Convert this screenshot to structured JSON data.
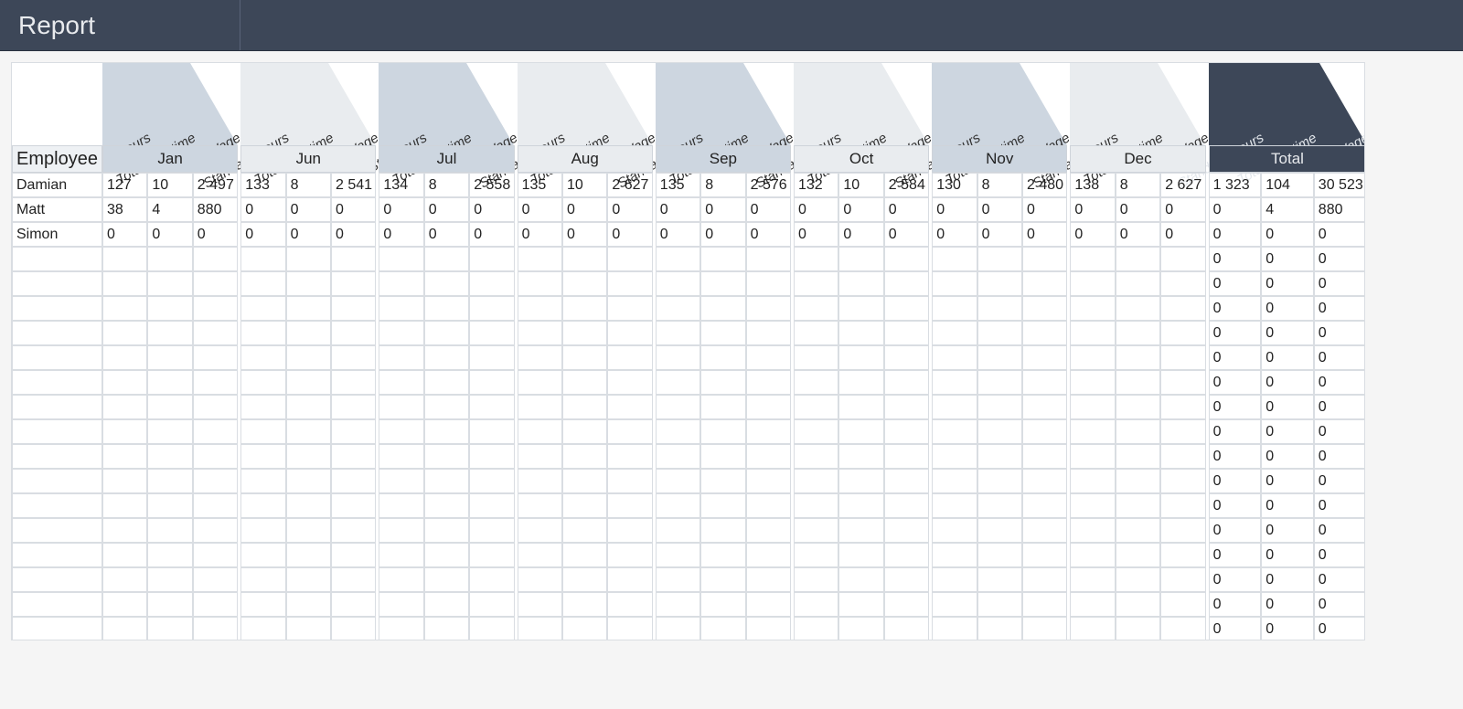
{
  "title": "Report",
  "column_label": "Employee",
  "sub_headers_short_first": [
    "Std. Hours",
    "Total Overtime",
    "Total Wage"
  ],
  "sub_headers_short_jul": [
    "Std. Hours",
    "Total Overtime",
    "Total Wage"
  ],
  "sub_headers_full": [
    "Standard Hours",
    "Total Overtime",
    "Total Wage"
  ],
  "periods": [
    "Jan",
    "Jun",
    "Jul",
    "Aug",
    "Sep",
    "Oct",
    "Nov",
    "Dec"
  ],
  "total_label": "Total",
  "period_shades": [
    "alt1",
    "alt2",
    "alt1",
    "alt2",
    "alt1",
    "alt2",
    "alt1",
    "alt2"
  ],
  "colors": {
    "alt1": "#cdd6e0",
    "alt2": "#e9ecef",
    "total_bg": "#3d4758",
    "total_fg": "#e8eaed"
  },
  "layout": {
    "name_w": 99,
    "sub_w": 49.4,
    "gap": 3,
    "total_sub_w": 57.6
  },
  "rows": [
    {
      "name": "Damian",
      "periods": [
        [
          "127",
          "10",
          "2 497"
        ],
        [
          "133",
          "8",
          "2 541"
        ],
        [
          "134",
          "8",
          "2 558"
        ],
        [
          "135",
          "10",
          "2 627"
        ],
        [
          "135",
          "8",
          "2 576"
        ],
        [
          "132",
          "10",
          "2 584"
        ],
        [
          "130",
          "8",
          "2 480"
        ],
        [
          "138",
          "8",
          "2 627"
        ]
      ],
      "total": [
        "1 323",
        "104",
        "30 523"
      ]
    },
    {
      "name": "Matt",
      "periods": [
        [
          "38",
          "4",
          "880"
        ],
        [
          "0",
          "0",
          "0"
        ],
        [
          "0",
          "0",
          "0"
        ],
        [
          "0",
          "0",
          "0"
        ],
        [
          "0",
          "0",
          "0"
        ],
        [
          "0",
          "0",
          "0"
        ],
        [
          "0",
          "0",
          "0"
        ],
        [
          "0",
          "0",
          "0"
        ]
      ],
      "total": [
        "0",
        "4",
        "880"
      ]
    },
    {
      "name": "Simon",
      "periods": [
        [
          "0",
          "0",
          "0"
        ],
        [
          "0",
          "0",
          "0"
        ],
        [
          "0",
          "0",
          "0"
        ],
        [
          "0",
          "0",
          "0"
        ],
        [
          "0",
          "0",
          "0"
        ],
        [
          "0",
          "0",
          "0"
        ],
        [
          "0",
          "0",
          "0"
        ],
        [
          "0",
          "0",
          "0"
        ]
      ],
      "total": [
        "0",
        "0",
        "0"
      ]
    }
  ],
  "empty_rows": 16,
  "empty_total": [
    "0",
    "0",
    "0"
  ]
}
